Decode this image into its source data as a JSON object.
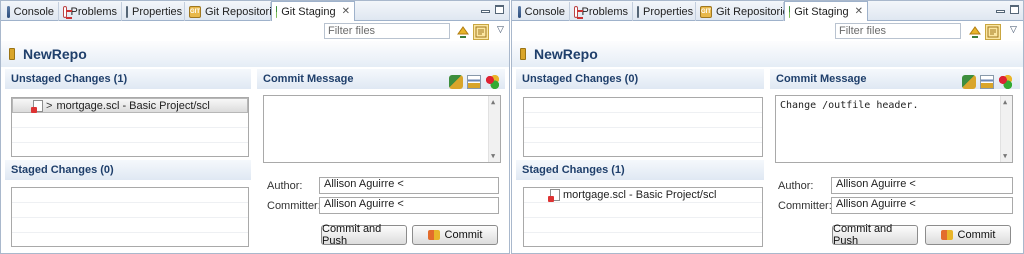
{
  "tabs": [
    "Console",
    "Problems",
    "Properties",
    "Git Repositories",
    "Git Staging"
  ],
  "filter_placeholder": "Filter files",
  "repo_name": "NewRepo",
  "left": {
    "unstaged_title": "Unstaged Changes (1)",
    "staged_title": "Staged Changes (0)",
    "unstaged_files": [
      {
        "prefix": ">",
        "name": "mortgage.scl - Basic Project/scl"
      }
    ],
    "staged_files": [],
    "commit_message_title": "Commit Message",
    "commit_message": "",
    "author_label": "Author:",
    "author": "Allison Aguirre <",
    "committer_label": "Committer:",
    "committer": "Allison Aguirre <",
    "commit_and_push_label": "Commit and Push",
    "commit_label": "Commit"
  },
  "right": {
    "unstaged_title": "Unstaged Changes (0)",
    "staged_title": "Staged Changes (1)",
    "unstaged_files": [],
    "staged_files": [
      {
        "name": "mortgage.scl - Basic Project/scl"
      }
    ],
    "commit_message_title": "Commit Message",
    "commit_message": "Change /outfile header.",
    "author_label": "Author:",
    "author": "Allison Aguirre <",
    "committer_label": "Committer:",
    "committer": "Allison Aguirre <",
    "commit_and_push_label": "Commit and Push",
    "commit_label": "Commit"
  }
}
